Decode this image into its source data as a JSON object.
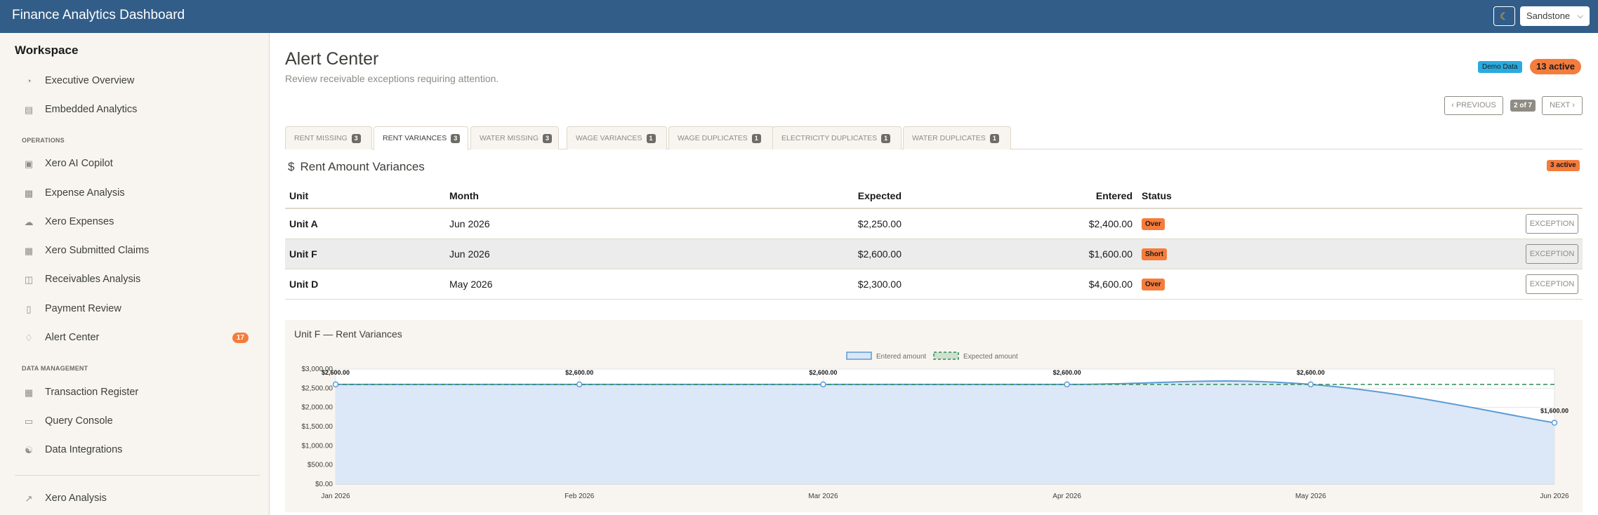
{
  "app": {
    "title": "Finance Analytics Dashboard",
    "theme": "Sandstone",
    "theme_icon": "moon-icon"
  },
  "sidebar": {
    "workspace_title": "Workspace",
    "items_top": [
      {
        "label": "Executive Overview",
        "icon": "speedometer-icon"
      },
      {
        "label": "Embedded Analytics",
        "icon": "window-icon"
      }
    ],
    "section_operations": "OPERATIONS",
    "items_operations": [
      {
        "label": "Xero AI Copilot",
        "icon": "robot-icon"
      },
      {
        "label": "Expense Analysis",
        "icon": "bar-chart-icon"
      },
      {
        "label": "Xero Expenses",
        "icon": "cloud-icon"
      },
      {
        "label": "Xero Submitted Claims",
        "icon": "receipt-icon"
      },
      {
        "label": "Receivables Analysis",
        "icon": "search-document-icon"
      },
      {
        "label": "Payment Review",
        "icon": "clipboard-icon"
      },
      {
        "label": "Alert Center",
        "icon": "bell-icon",
        "count": "17"
      }
    ],
    "section_data": "DATA MANAGEMENT",
    "items_data": [
      {
        "label": "Transaction Register",
        "icon": "table-icon"
      },
      {
        "label": "Query Console",
        "icon": "terminal-icon"
      },
      {
        "label": "Data Integrations",
        "icon": "diagram-icon"
      }
    ],
    "items_bottom": [
      {
        "label": "Xero Analysis",
        "icon": "line-chart-icon"
      }
    ]
  },
  "header": {
    "title": "Alert Center",
    "subtitle": "Review receivable exceptions requiring attention.",
    "demo_badge": "Demo Data",
    "active_badge": "13 active"
  },
  "pager": {
    "previous": "PREVIOUS",
    "count": "2 of 7",
    "next": "NEXT"
  },
  "tabs": [
    {
      "label": "RENT MISSING",
      "count": "3"
    },
    {
      "label": "RENT VARIANCES",
      "count": "3"
    },
    {
      "label": "WATER MISSING",
      "count": "3"
    },
    {
      "label": "WAGE VARIANCES",
      "count": "1"
    },
    {
      "label": "WAGE DUPLICATES",
      "count": "1"
    },
    {
      "label": "ELECTRICITY DUPLICATES",
      "count": "1"
    },
    {
      "label": "WATER DUPLICATES",
      "count": "1"
    }
  ],
  "panel": {
    "icon_symbol": "$",
    "title": "Rent Amount Variances",
    "badge": "3 active",
    "columns": [
      "Unit",
      "Month",
      "Expected",
      "Entered",
      "Status"
    ],
    "rows": [
      {
        "unit": "Unit A",
        "month": "Jun 2026",
        "expected": "$2,250.00",
        "entered": "$2,400.00",
        "status": "Over",
        "action": "EXCEPTION"
      },
      {
        "unit": "Unit F",
        "month": "Jun 2026",
        "expected": "$2,600.00",
        "entered": "$1,600.00",
        "status": "Short",
        "action": "EXCEPTION"
      },
      {
        "unit": "Unit D",
        "month": "May 2026",
        "expected": "$2,300.00",
        "entered": "$4,600.00",
        "status": "Over",
        "action": "EXCEPTION"
      }
    ]
  },
  "chart_data": {
    "type": "line",
    "title": "Unit F — Rent Variances",
    "categories": [
      "Jan 2026",
      "Feb 2026",
      "Mar 2026",
      "Apr 2026",
      "May 2026",
      "Jun 2026"
    ],
    "series": [
      {
        "name": "Entered amount",
        "values": [
          2600,
          2600,
          2600,
          2600,
          2600,
          1600
        ],
        "labels": [
          "$2,600.00",
          "$2,600.00",
          "$2,600.00",
          "$2,600.00",
          "$2,600.00",
          "$1,600.00"
        ],
        "color": "#5b9bd5",
        "fill": "#dae6f7"
      },
      {
        "name": "Expected amount",
        "values": [
          2600,
          2600,
          2600,
          2600,
          2600,
          2600
        ],
        "color": "#2e8b57",
        "dashed": true
      }
    ],
    "yticks": [
      "$0.00",
      "$500.00",
      "$1,000.00",
      "$1,500.00",
      "$2,000.00",
      "$2,500.00",
      "$3,000.00"
    ],
    "ylim": [
      0,
      3000
    ],
    "grid": true,
    "legend": "top-center"
  }
}
